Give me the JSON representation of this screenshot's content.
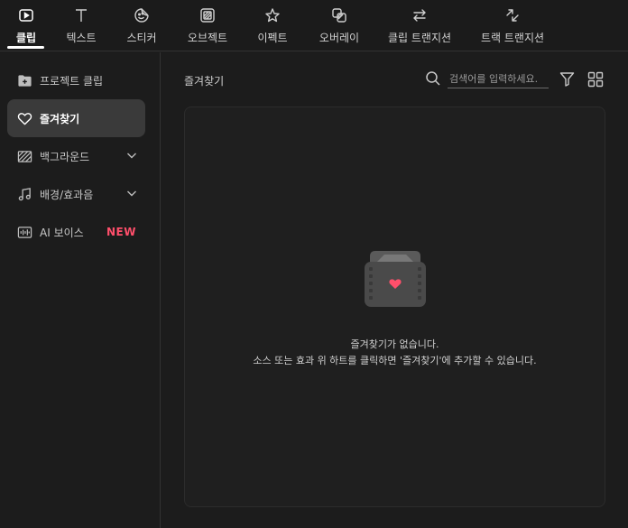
{
  "tabs": [
    {
      "label": "클립",
      "icon": "play-square-icon",
      "active": true
    },
    {
      "label": "텍스트",
      "icon": "text-t-icon"
    },
    {
      "label": "스티커",
      "icon": "sticker-icon"
    },
    {
      "label": "오브젝트",
      "icon": "object-icon"
    },
    {
      "label": "이펙트",
      "icon": "star-icon"
    },
    {
      "label": "오버레이",
      "icon": "overlay-icon"
    },
    {
      "label": "클립 트랜지션",
      "icon": "swap-arrows-icon"
    },
    {
      "label": "트랙 트랜지션",
      "icon": "diagonal-arrows-icon"
    }
  ],
  "sidebar": {
    "items": [
      {
        "label": "프로젝트 클립",
        "icon": "folder-plus-icon"
      },
      {
        "label": "즐겨찾기",
        "icon": "heart-icon",
        "active": true
      },
      {
        "label": "백그라운드",
        "icon": "hatch-pattern-icon",
        "expandable": true
      },
      {
        "label": "배경/효과음",
        "icon": "music-note-icon",
        "expandable": true
      },
      {
        "label": "AI 보이스",
        "icon": "waveform-icon",
        "badge": "NEW"
      }
    ]
  },
  "main": {
    "title": "즐겨찾기",
    "search_placeholder": "검색어를 입력하세요.",
    "empty_title": "즐겨찾기가 없습니다.",
    "empty_desc": "소스 또는 효과 위 하트를 클릭하면 '즐겨찾기'에 추가할 수 있습니다."
  },
  "colors": {
    "background": "#1c1c1c",
    "active_item": "#3a3a3a",
    "badge": "#ff4f6b",
    "heart": "#ff4f6b"
  }
}
